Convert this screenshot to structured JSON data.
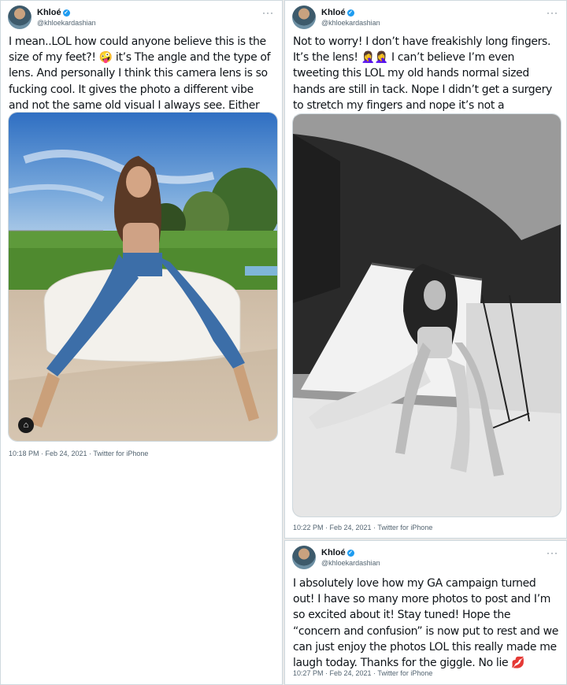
{
  "tweets": [
    {
      "name": "Khloé",
      "handle": "@khloekardashian",
      "text": "I mean..LOL how could anyone believe this is the size of my feet?! 🤪 it’s The angle and the type of lens. And personally I think this camera lens is so fucking cool. It gives the photo a different vibe and not the same old visual I always see. Either way, I’m happy with them",
      "timestamp": "10:18 PM · Feb 24, 2021 · Twitter for iPhone"
    },
    {
      "name": "Khloé",
      "handle": "@khloekardashian",
      "text": "Not to worry! I don’t have freakishly long fingers. It’s the lens! 🤦‍♀️🤦‍♀️ I can’t believe I’m even tweeting this LOL my old hands normal sized hands are still in tack. Nope I didn’t get a surgery to stretch my fingers and nope it’s not a “photoshop fail”. Have a great day 💋",
      "timestamp": "10:22 PM · Feb 24, 2021 · Twitter for iPhone"
    },
    {
      "name": "Khloé",
      "handle": "@khloekardashian",
      "text": "I absolutely love how my GA campaign turned out! I have so many more photos to post and I’m so excited about it! Stay tuned! Hope the “concern and confusion” is now put to rest and we can just enjoy the photos LOL this really made me laugh today. Thanks for the giggle. No lie 💋",
      "timestamp": "10:27 PM · Feb 24, 2021 · Twitter for iPhone"
    }
  ],
  "icons": {
    "verified": "verified-badge-icon",
    "more": "more-options-icon",
    "shop": "shopping-bag-icon"
  },
  "colors": {
    "verified": "#1d9bf0",
    "meta": "#536471",
    "border": "#cfd9de"
  }
}
